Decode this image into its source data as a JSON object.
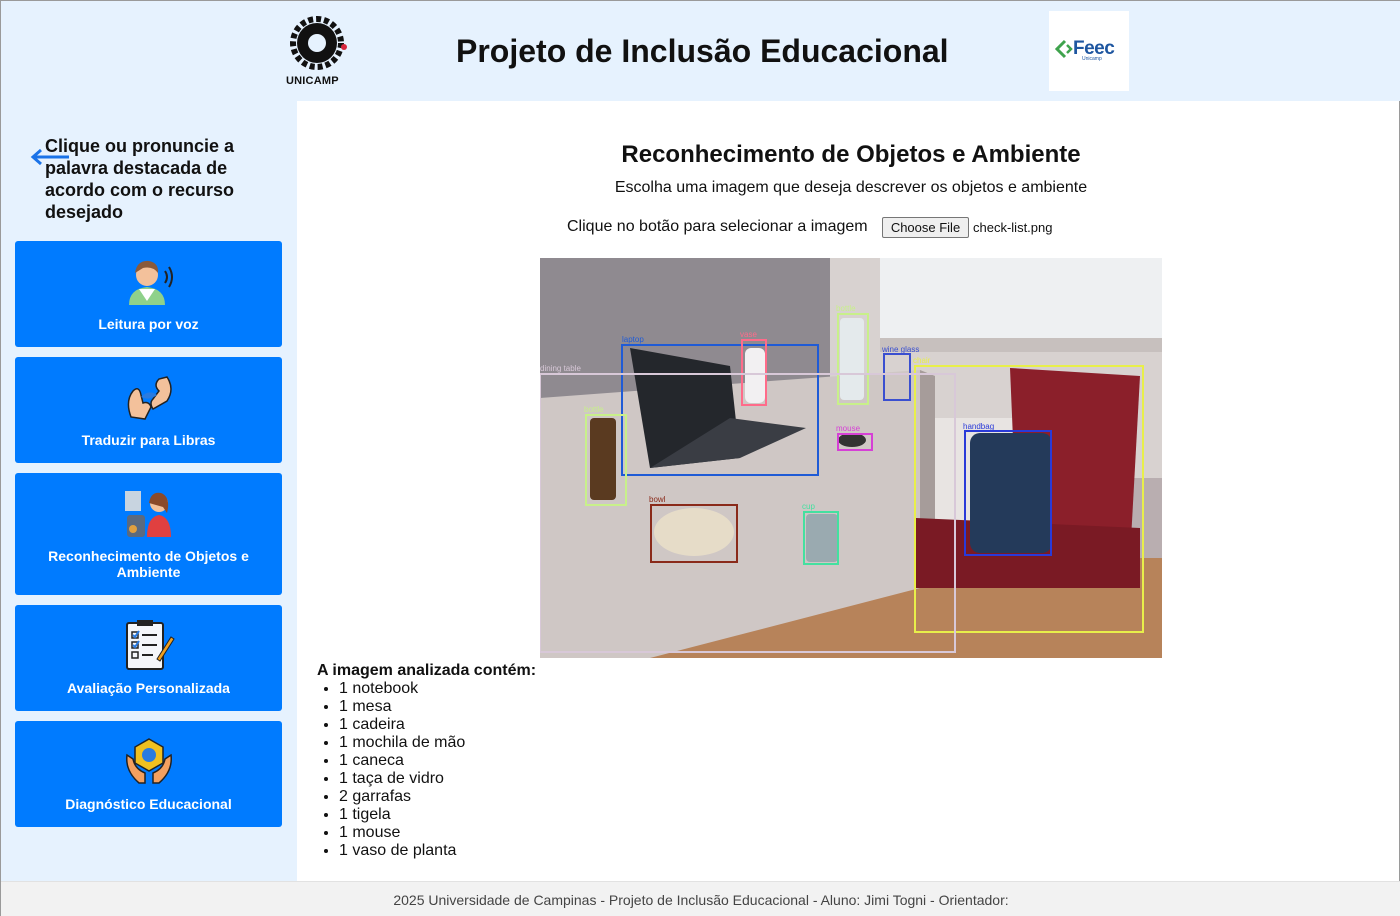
{
  "header": {
    "title": "Projeto de Inclusão Educacional",
    "unicamp_logo_text": "UNICAMP",
    "feec_logo_text": "Feec",
    "feec_logo_subtext": "Unicamp",
    "colors": {
      "background": "#e6f2fe",
      "feec": "#1e56a0",
      "unicamp": "#111111"
    }
  },
  "sidebar": {
    "back_icon": "arrow-left-icon",
    "instruction": "Clique ou pronuncie a palavra destacada de acordo com o recurso desejado",
    "items": [
      {
        "label": "Leitura por voz",
        "icon": "person-speaking-icon"
      },
      {
        "label": "Traduzir para Libras",
        "icon": "sign-language-hands-icon"
      },
      {
        "label": "Reconhecimento de Objetos e Ambiente",
        "icon": "objects-recognition-icon"
      },
      {
        "label": "Avaliação Personalizada",
        "icon": "checklist-clipboard-icon"
      },
      {
        "label": "Diagnóstico Educacional",
        "icon": "hands-diagnosis-icon"
      }
    ],
    "colors": {
      "card": "#007bff",
      "background": "#e6f2fe"
    }
  },
  "main": {
    "title": "Reconhecimento de Objetos e Ambiente",
    "subtitle": "Escolha uma imagem que deseja descrever os objetos e ambiente",
    "file_prompt": "Clique no botão para selecionar a imagem",
    "file_button": "Choose File",
    "file_name": "check-list.png",
    "detections": [
      {
        "label": "laptop",
        "color": "#1f5bd6"
      },
      {
        "label": "vase",
        "color": "#ff6b8a"
      },
      {
        "label": "bottle",
        "color": "#c8f08a"
      },
      {
        "label": "wine glass",
        "color": "#3a4fd0"
      },
      {
        "label": "chair",
        "color": "#e8ef4a"
      },
      {
        "label": "dining table",
        "color": "#d8c8d8"
      },
      {
        "label": "bottle",
        "color": "#c8f08a"
      },
      {
        "label": "mouse",
        "color": "#d640d6"
      },
      {
        "label": "handbag",
        "color": "#2a3ad8"
      },
      {
        "label": "bowl",
        "color": "#8a2a1a"
      },
      {
        "label": "cup",
        "color": "#44e0a0"
      }
    ],
    "results_heading": "A imagem analizada contém:",
    "results": [
      "1 notebook",
      "1 mesa",
      "1 cadeira",
      "1 mochila de mão",
      "1 caneca",
      "1 taça de vidro",
      "2 garrafas",
      "1 tigela",
      "1 mouse",
      "1 vaso de planta"
    ]
  },
  "footer": {
    "text": "2025 Universidade de Campinas - Projeto de Inclusão Educacional - Aluno: Jimi Togni - Orientador:"
  }
}
